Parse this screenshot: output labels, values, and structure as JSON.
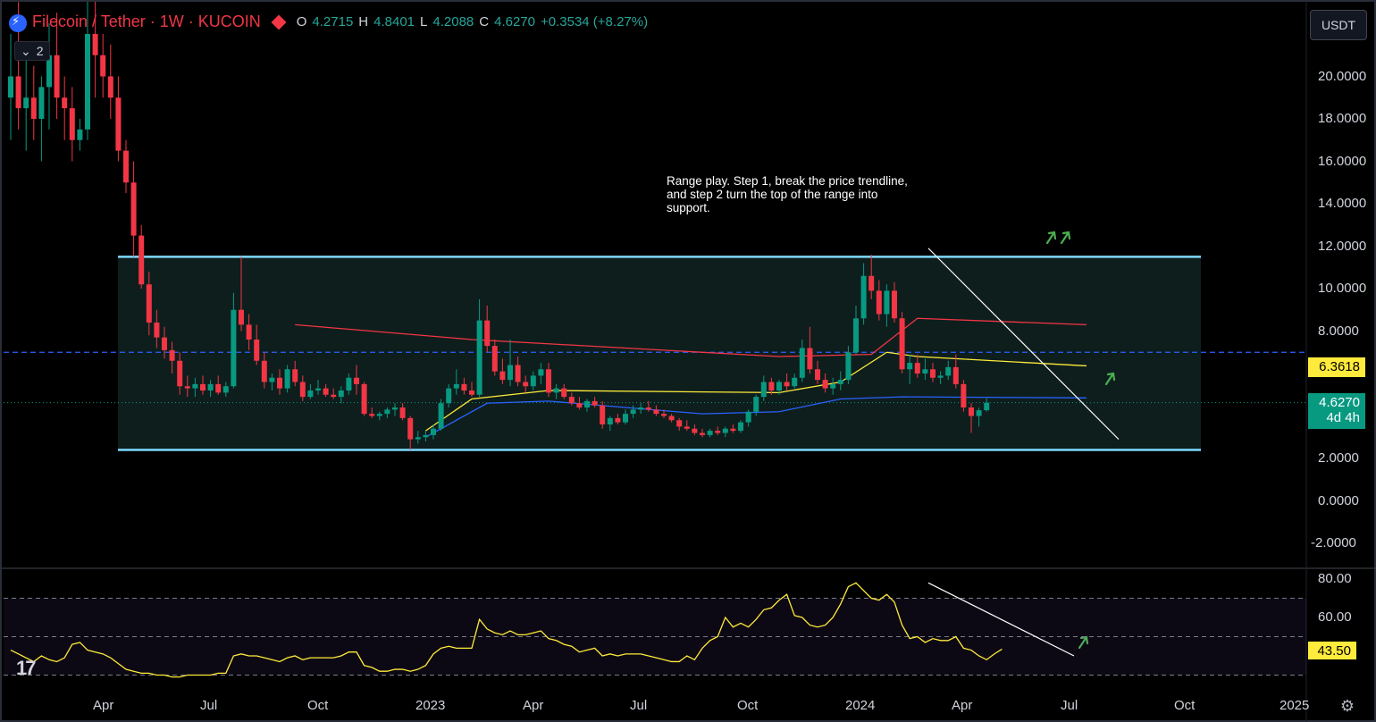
{
  "header": {
    "symbol": "Filecoin / Tether · 1W · KUCOIN",
    "ohlc": {
      "o_label": "O",
      "o": "4.2715",
      "h_label": "H",
      "h": "4.8401",
      "l_label": "L",
      "l": "4.2088",
      "c_label": "C",
      "c": "4.6270",
      "change": "+0.3534 (+8.27%)"
    },
    "indicator_count": "2",
    "currency_button": "USDT"
  },
  "note": "Range play. Step 1, break the price trendline, and step 2 turn the top of the range into support.",
  "price_axis": [
    "20.0000",
    "18.0000",
    "16.0000",
    "14.0000",
    "12.0000",
    "10.0000",
    "8.0000",
    "2.0000",
    "0.0000",
    "-2.0000"
  ],
  "price_tags": {
    "avg": "6.3618",
    "last": "4.6270",
    "countdown": "4d 4h"
  },
  "rsi_axis": [
    "80.00",
    "60.00"
  ],
  "rsi_value": "43.50",
  "time_axis": [
    "Apr",
    "Jul",
    "Oct",
    "2023",
    "Apr",
    "Jul",
    "Oct",
    "2024",
    "Apr",
    "Jul",
    "Oct",
    "2025"
  ],
  "colors": {
    "up": "#089981",
    "down": "#f23645",
    "range_line": "#7fdbff",
    "ema_red": "#f23645",
    "ema_yellow": "#ffeb3b",
    "ema_blue": "#2962ff",
    "rsi_line": "#ffeb3b",
    "arrow": "#4caf50"
  },
  "chart_data": {
    "type": "candlestick",
    "ylim": [
      -2.8,
      21.4
    ],
    "range_box": {
      "top": 11.5,
      "bottom": 2.4
    },
    "dashed_level": 7.0,
    "candles_ohlc": [
      [
        19.0,
        22.0,
        17.0,
        20.0
      ],
      [
        20.0,
        23.5,
        17.5,
        18.5
      ],
      [
        18.5,
        21.0,
        16.5,
        19.0
      ],
      [
        19.0,
        20.5,
        17.0,
        18.0
      ],
      [
        18.0,
        20.0,
        16.0,
        19.5
      ],
      [
        19.5,
        22.5,
        17.5,
        21.0
      ],
      [
        21.0,
        23.0,
        18.0,
        19.0
      ],
      [
        19.0,
        20.0,
        17.0,
        18.5
      ],
      [
        18.5,
        19.5,
        16.0,
        17.0
      ],
      [
        17.0,
        18.0,
        16.5,
        17.5
      ],
      [
        17.5,
        25.0,
        17.0,
        22.0
      ],
      [
        22.0,
        24.0,
        19.0,
        21.0
      ],
      [
        21.0,
        22.0,
        19.0,
        20.0
      ],
      [
        20.0,
        21.5,
        18.0,
        19.0
      ],
      [
        19.0,
        20.0,
        16.0,
        16.5
      ],
      [
        16.5,
        17.0,
        14.5,
        15.0
      ],
      [
        15.0,
        16.0,
        11.5,
        12.5
      ],
      [
        12.5,
        13.0,
        10.0,
        10.2
      ],
      [
        10.2,
        10.8,
        7.8,
        8.4
      ],
      [
        8.4,
        9.0,
        7.2,
        7.7
      ],
      [
        7.7,
        8.2,
        6.7,
        7.1
      ],
      [
        7.1,
        7.5,
        6.0,
        6.6
      ],
      [
        6.6,
        7.0,
        5.0,
        5.4
      ],
      [
        5.4,
        5.9,
        4.9,
        5.3
      ],
      [
        5.3,
        5.8,
        4.9,
        5.5
      ],
      [
        5.5,
        5.9,
        5.0,
        5.2
      ],
      [
        5.2,
        5.7,
        4.9,
        5.5
      ],
      [
        5.5,
        5.9,
        5.0,
        5.1
      ],
      [
        5.1,
        5.6,
        4.9,
        5.4
      ],
      [
        5.4,
        9.8,
        5.3,
        9.0
      ],
      [
        9.0,
        11.5,
        8.0,
        8.3
      ],
      [
        8.3,
        8.8,
        7.1,
        7.6
      ],
      [
        7.6,
        8.3,
        6.4,
        6.6
      ],
      [
        6.6,
        7.0,
        5.3,
        5.6
      ],
      [
        5.6,
        6.0,
        5.2,
        5.8
      ],
      [
        5.8,
        6.2,
        5.0,
        5.3
      ],
      [
        5.3,
        6.4,
        5.1,
        6.2
      ],
      [
        6.2,
        6.6,
        5.4,
        5.6
      ],
      [
        5.6,
        5.9,
        4.7,
        4.9
      ],
      [
        4.9,
        5.5,
        4.8,
        5.2
      ],
      [
        5.2,
        5.7,
        5.0,
        5.3
      ],
      [
        5.3,
        5.5,
        4.9,
        5.0
      ],
      [
        5.0,
        5.3,
        4.8,
        4.9
      ],
      [
        4.9,
        5.4,
        4.6,
        5.2
      ],
      [
        5.2,
        6.0,
        5.0,
        5.8
      ],
      [
        5.8,
        6.4,
        5.0,
        5.5
      ],
      [
        5.5,
        5.6,
        4.0,
        4.1
      ],
      [
        4.1,
        4.4,
        3.9,
        4.0
      ],
      [
        4.0,
        4.2,
        3.8,
        4.1
      ],
      [
        4.1,
        4.4,
        3.9,
        4.3
      ],
      [
        4.3,
        4.6,
        4.0,
        4.4
      ],
      [
        4.4,
        4.6,
        3.8,
        3.9
      ],
      [
        3.9,
        4.0,
        2.4,
        2.9
      ],
      [
        2.9,
        3.3,
        2.7,
        3.0
      ],
      [
        3.0,
        3.3,
        2.8,
        3.1
      ],
      [
        3.1,
        3.6,
        2.9,
        3.4
      ],
      [
        3.4,
        4.8,
        3.3,
        4.6
      ],
      [
        4.6,
        5.5,
        4.4,
        5.3
      ],
      [
        5.3,
        6.2,
        5.0,
        5.5
      ],
      [
        5.5,
        5.8,
        5.0,
        5.2
      ],
      [
        5.2,
        5.6,
        4.9,
        5.0
      ],
      [
        5.0,
        9.5,
        4.9,
        8.5
      ],
      [
        8.5,
        9.2,
        7.0,
        7.3
      ],
      [
        7.3,
        7.6,
        5.9,
        6.1
      ],
      [
        6.1,
        6.7,
        5.5,
        5.7
      ],
      [
        5.7,
        7.6,
        5.4,
        6.4
      ],
      [
        6.4,
        6.8,
        5.4,
        5.6
      ],
      [
        5.6,
        5.9,
        5.1,
        5.4
      ],
      [
        5.4,
        6.1,
        5.2,
        5.9
      ],
      [
        5.9,
        6.5,
        5.5,
        6.2
      ],
      [
        6.2,
        6.5,
        4.9,
        5.1
      ],
      [
        5.1,
        5.5,
        4.8,
        5.3
      ],
      [
        5.3,
        5.5,
        4.8,
        4.9
      ],
      [
        4.9,
        5.1,
        4.5,
        4.6
      ],
      [
        4.6,
        4.9,
        4.3,
        4.4
      ],
      [
        4.4,
        4.8,
        4.2,
        4.7
      ],
      [
        4.7,
        4.9,
        4.4,
        4.5
      ],
      [
        4.5,
        4.7,
        3.4,
        3.6
      ],
      [
        3.6,
        4.0,
        3.3,
        3.9
      ],
      [
        3.9,
        4.1,
        3.6,
        3.7
      ],
      [
        3.7,
        4.3,
        3.6,
        4.1
      ],
      [
        4.1,
        4.5,
        3.9,
        4.3
      ],
      [
        4.3,
        4.6,
        4.1,
        4.4
      ],
      [
        4.4,
        4.7,
        4.2,
        4.3
      ],
      [
        4.3,
        4.5,
        4.0,
        4.1
      ],
      [
        4.1,
        4.3,
        3.9,
        4.0
      ],
      [
        4.0,
        4.1,
        3.7,
        3.8
      ],
      [
        3.8,
        3.9,
        3.3,
        3.5
      ],
      [
        3.5,
        3.8,
        3.3,
        3.4
      ],
      [
        3.4,
        3.6,
        3.1,
        3.2
      ],
      [
        3.2,
        3.4,
        3.0,
        3.1
      ],
      [
        3.1,
        3.4,
        3.0,
        3.3
      ],
      [
        3.3,
        3.5,
        3.1,
        3.2
      ],
      [
        3.2,
        3.5,
        3.0,
        3.4
      ],
      [
        3.4,
        3.6,
        3.2,
        3.3
      ],
      [
        3.3,
        3.8,
        3.2,
        3.7
      ],
      [
        3.7,
        4.3,
        3.5,
        4.2
      ],
      [
        4.2,
        5.0,
        4.0,
        4.9
      ],
      [
        4.9,
        5.9,
        4.7,
        5.6
      ],
      [
        5.6,
        5.8,
        5.0,
        5.2
      ],
      [
        5.2,
        5.7,
        5.0,
        5.6
      ],
      [
        5.6,
        6.0,
        5.2,
        5.4
      ],
      [
        5.4,
        6.0,
        5.3,
        5.8
      ],
      [
        5.8,
        7.6,
        5.6,
        7.2
      ],
      [
        7.2,
        8.2,
        6.0,
        6.2
      ],
      [
        6.2,
        6.6,
        5.5,
        5.7
      ],
      [
        5.7,
        6.0,
        5.1,
        5.3
      ],
      [
        5.3,
        5.8,
        5.0,
        5.5
      ],
      [
        5.5,
        6.1,
        5.2,
        5.7
      ],
      [
        5.7,
        7.3,
        5.5,
        7.0
      ],
      [
        7.0,
        9.2,
        6.9,
        8.6
      ],
      [
        8.6,
        11.2,
        8.3,
        10.6
      ],
      [
        10.6,
        11.6,
        9.5,
        9.9
      ],
      [
        9.9,
        10.4,
        8.5,
        8.8
      ],
      [
        8.8,
        10.2,
        8.2,
        9.9
      ],
      [
        9.9,
        10.3,
        8.4,
        8.6
      ],
      [
        8.6,
        8.9,
        6.0,
        6.2
      ],
      [
        6.2,
        6.9,
        5.5,
        6.5
      ],
      [
        6.5,
        6.9,
        5.8,
        6.0
      ],
      [
        6.0,
        6.7,
        5.7,
        6.2
      ],
      [
        6.2,
        6.5,
        5.6,
        5.8
      ],
      [
        5.8,
        6.1,
        5.5,
        5.9
      ],
      [
        5.9,
        6.6,
        5.7,
        6.3
      ],
      [
        6.3,
        6.9,
        5.3,
        5.5
      ],
      [
        5.5,
        5.7,
        4.2,
        4.4
      ],
      [
        4.4,
        4.6,
        3.2,
        4.0
      ],
      [
        4.0,
        4.4,
        3.5,
        4.27
      ],
      [
        4.27,
        4.84,
        4.21,
        4.627
      ]
    ],
    "ema_red": [
      [
        37,
        8.3
      ],
      [
        60,
        7.6
      ],
      [
        100,
        6.8
      ],
      [
        112,
        6.9
      ],
      [
        118,
        8.6
      ],
      [
        140,
        8.3
      ]
    ],
    "ema_yellow": [
      [
        54,
        3.3
      ],
      [
        60,
        4.8
      ],
      [
        70,
        5.2
      ],
      [
        100,
        5.1
      ],
      [
        108,
        5.6
      ],
      [
        114,
        7.0
      ],
      [
        118,
        6.8
      ],
      [
        140,
        6.36
      ]
    ],
    "ema_blue": [
      [
        54,
        3.0
      ],
      [
        62,
        4.6
      ],
      [
        70,
        4.7
      ],
      [
        80,
        4.4
      ],
      [
        90,
        4.1
      ],
      [
        100,
        4.2
      ],
      [
        108,
        4.8
      ],
      [
        116,
        4.9
      ],
      [
        140,
        4.85
      ]
    ],
    "trendline": [
      [
        114,
        11.9
      ],
      [
        143,
        2.9
      ]
    ],
    "rsi": {
      "ylim": [
        20,
        86
      ],
      "levels": [
        70,
        50,
        30
      ],
      "values": [
        43,
        41,
        39,
        37,
        40,
        38,
        37,
        39,
        46,
        47,
        43,
        42,
        41,
        39,
        36,
        33,
        32,
        31,
        31,
        30,
        30,
        29,
        29,
        30,
        30,
        30,
        30,
        31,
        31,
        40,
        41,
        40,
        40,
        39,
        38,
        37,
        39,
        40,
        38,
        39,
        39,
        39,
        39,
        40,
        42,
        42,
        35,
        34,
        32,
        32,
        33,
        33,
        32,
        33,
        35,
        41,
        44,
        45,
        44,
        44,
        44,
        59,
        54,
        52,
        51,
        53,
        51,
        51,
        52,
        53,
        49,
        48,
        46,
        45,
        42,
        43,
        44,
        40,
        41,
        40,
        41,
        41,
        41,
        40,
        39,
        38,
        37,
        37,
        40,
        38,
        44,
        48,
        50,
        60,
        55,
        57,
        55,
        59,
        64,
        65,
        69,
        72,
        61,
        60,
        56,
        55,
        56,
        60,
        67,
        76,
        78,
        74,
        70,
        69,
        72,
        68,
        56,
        49,
        50,
        47,
        49,
        48,
        48,
        50,
        44,
        43,
        40,
        38,
        41,
        43.5
      ],
      "trendline": [
        [
          115,
          78
        ],
        [
          141,
          40
        ]
      ]
    }
  }
}
